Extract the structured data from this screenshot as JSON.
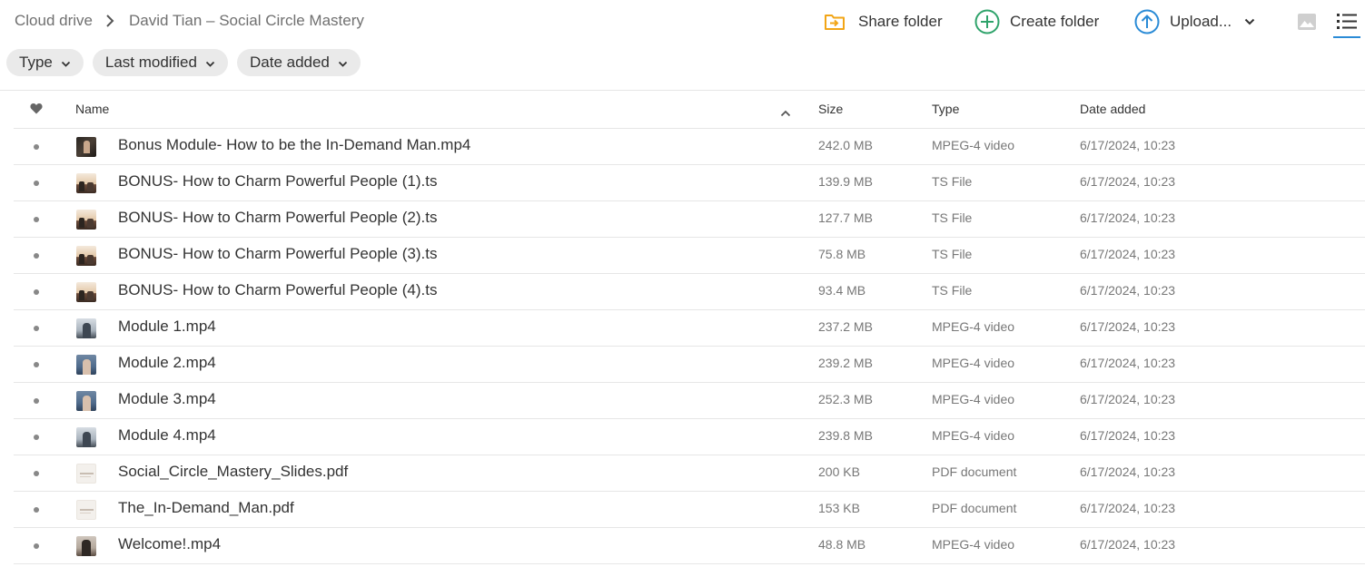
{
  "breadcrumb": {
    "root": "Cloud drive",
    "current": "David Tian – Social Circle Mastery"
  },
  "actions": {
    "share_folder": "Share folder",
    "create_folder": "Create folder",
    "upload": "Upload..."
  },
  "colors": {
    "share_icon": "#f2a516",
    "create_icon": "#2fa36b",
    "upload_icon": "#2a8bd6",
    "active_view": "#2a8bd6"
  },
  "filters": [
    {
      "label": "Type"
    },
    {
      "label": "Last modified"
    },
    {
      "label": "Date added"
    }
  ],
  "table": {
    "headers": {
      "name": "Name",
      "size": "Size",
      "type": "Type",
      "date": "Date added"
    },
    "sort_direction": "ascending",
    "rows": [
      {
        "name": "Bonus Module- How to be the In-Demand Man.mp4",
        "size": "242.0 MB",
        "type": "MPEG-4 video",
        "date": "6/17/2024, 10:23",
        "thumb": "dark"
      },
      {
        "name": "BONUS- How to Charm Powerful People (1).ts",
        "size": "139.9 MB",
        "type": "TS File",
        "date": "6/17/2024, 10:23",
        "thumb": "room"
      },
      {
        "name": "BONUS- How to Charm Powerful People (2).ts",
        "size": "127.7 MB",
        "type": "TS File",
        "date": "6/17/2024, 10:23",
        "thumb": "room"
      },
      {
        "name": "BONUS- How to Charm Powerful People (3).ts",
        "size": "75.8 MB",
        "type": "TS File",
        "date": "6/17/2024, 10:23",
        "thumb": "room"
      },
      {
        "name": "BONUS- How to Charm Powerful People (4).ts",
        "size": "93.4 MB",
        "type": "TS File",
        "date": "6/17/2024, 10:23",
        "thumb": "room"
      },
      {
        "name": "Module 1.mp4",
        "size": "237.2 MB",
        "type": "MPEG-4 video",
        "date": "6/17/2024, 10:23",
        "thumb": "office"
      },
      {
        "name": "Module 2.mp4",
        "size": "239.2 MB",
        "type": "MPEG-4 video",
        "date": "6/17/2024, 10:23",
        "thumb": "blue"
      },
      {
        "name": "Module 3.mp4",
        "size": "252.3 MB",
        "type": "MPEG-4 video",
        "date": "6/17/2024, 10:23",
        "thumb": "blue"
      },
      {
        "name": "Module 4.mp4",
        "size": "239.8 MB",
        "type": "MPEG-4 video",
        "date": "6/17/2024, 10:23",
        "thumb": "office"
      },
      {
        "name": "Social_Circle_Mastery_Slides.pdf",
        "size": "200 KB",
        "type": "PDF document",
        "date": "6/17/2024, 10:23",
        "thumb": "doc"
      },
      {
        "name": "The_In-Demand_Man.pdf",
        "size": "153 KB",
        "type": "PDF document",
        "date": "6/17/2024, 10:23",
        "thumb": "doc"
      },
      {
        "name": "Welcome!.mp4",
        "size": "48.8 MB",
        "type": "MPEG-4 video",
        "date": "6/17/2024, 10:23",
        "thumb": "person"
      }
    ]
  }
}
